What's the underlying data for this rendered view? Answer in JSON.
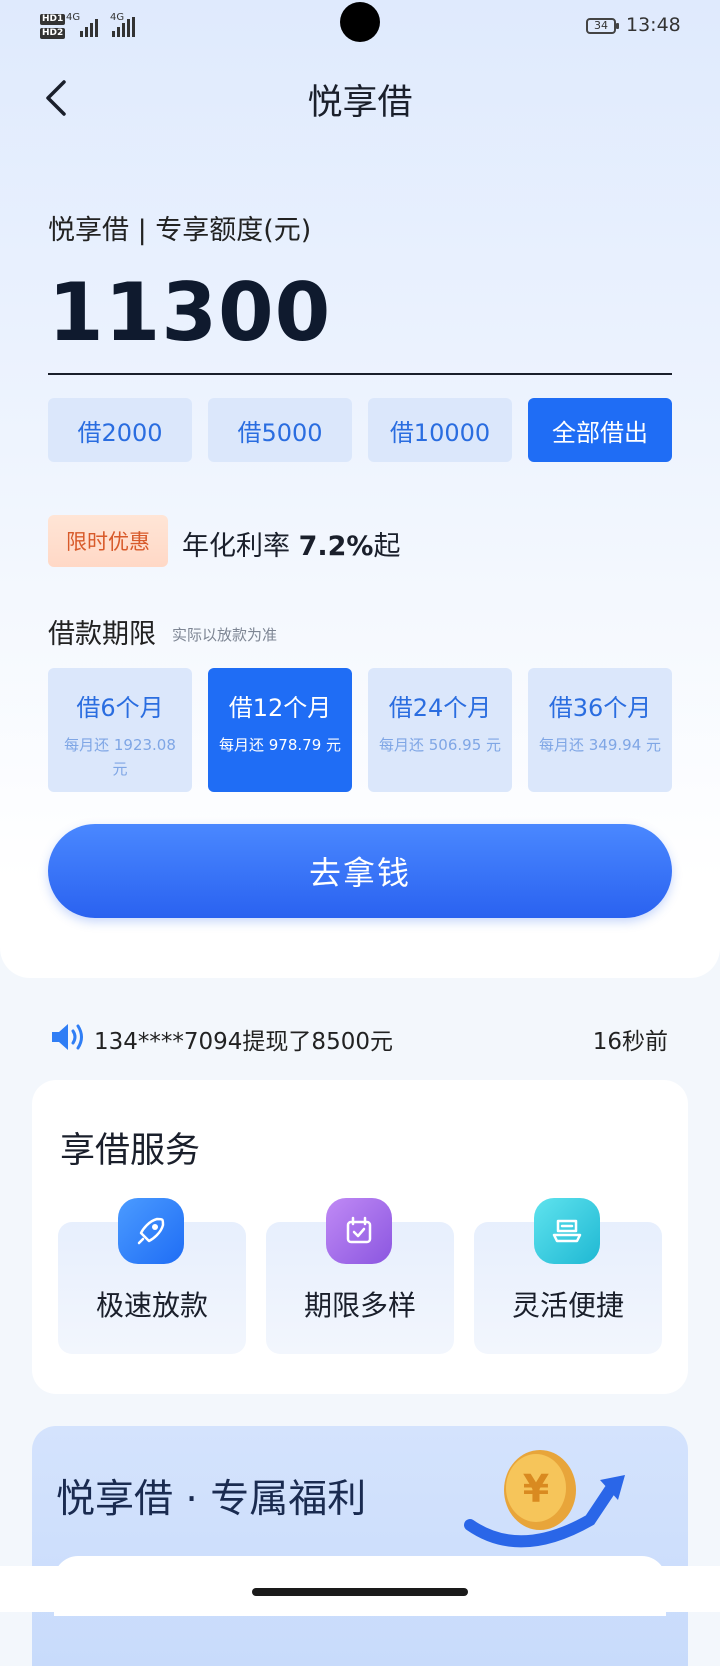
{
  "status_bar": {
    "hd1": "HD1",
    "hd2": "HD2",
    "sig1": "4G",
    "sig2": "4G",
    "battery": "34",
    "time": "13:48"
  },
  "header": {
    "title": "悦享借",
    "back_icon": "chevron-left-icon"
  },
  "quota": {
    "label": "悦享借 | 专享额度(元)",
    "amount": "11300"
  },
  "amount_options": [
    {
      "label": "借2000",
      "active": false
    },
    {
      "label": "借5000",
      "active": false
    },
    {
      "label": "借10000",
      "active": false
    },
    {
      "label": "全部借出",
      "active": true
    }
  ],
  "promo": {
    "badge": "限时优惠",
    "prefix": "年化利率 ",
    "rate": "7.2%",
    "suffix": "起"
  },
  "term": {
    "title": "借款期限",
    "note": "实际以放款为准",
    "options": [
      {
        "label": "借6个月",
        "monthly": "每月还 1923.08 元",
        "active": false
      },
      {
        "label": "借12个月",
        "monthly": "每月还 978.79 元",
        "active": true
      },
      {
        "label": "借24个月",
        "monthly": "每月还 506.95 元",
        "active": false
      },
      {
        "label": "借36个月",
        "monthly": "每月还 349.94 元",
        "active": false
      }
    ]
  },
  "cta": {
    "label": "去拿钱"
  },
  "ticker": {
    "icon": "speaker-icon",
    "text": "134****7094提现了8500元",
    "time": "16秒前"
  },
  "services": {
    "title": "享借服务",
    "items": [
      {
        "label": "极速放款",
        "icon": "rocket-icon",
        "color": "#2f7ef5"
      },
      {
        "label": "期限多样",
        "icon": "calendar-icon",
        "color": "#9a63e8"
      },
      {
        "label": "灵活便捷",
        "icon": "tray-icon",
        "color": "#29c5d9"
      }
    ]
  },
  "welfare": {
    "title": "悦享借 · 专属福利",
    "coin_symbol": "¥"
  },
  "colors": {
    "primary": "#1f6df5",
    "chip_bg": "#dbe7fb",
    "promo": "#d85a2a"
  }
}
